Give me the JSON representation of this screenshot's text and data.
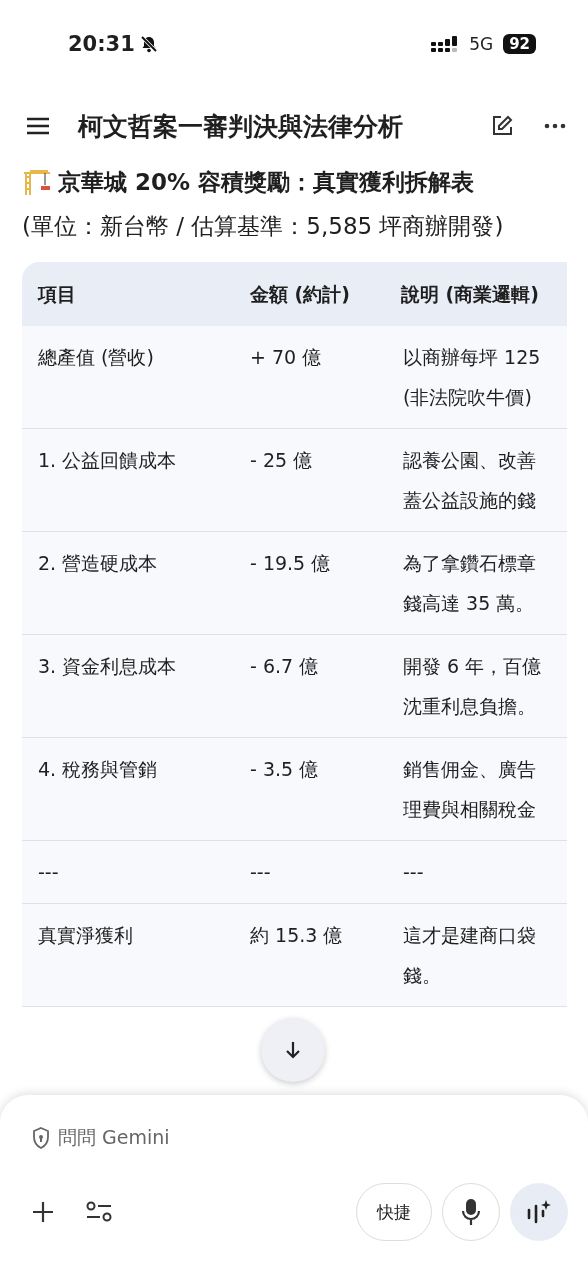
{
  "status_bar": {
    "time": "20:31",
    "network": "5G",
    "battery": "92"
  },
  "header": {
    "title": "柯文哲案一審判決與法律分析"
  },
  "heading": "京華城 20% 容積獎勵：真實獲利拆解表",
  "subtitle": "(單位：新台幣 / 估算基準：5,585 坪商辦開發)",
  "table": {
    "columns": [
      "項目",
      "金額 (約計)",
      "說明 (商業邏輯)"
    ],
    "rows": [
      {
        "item": "總產值 (營收)",
        "amount": "+ 70 億",
        "note": [
          "以商辦每坪 125",
          "(非法院吹牛價)"
        ]
      },
      {
        "item": "1. 公益回饋成本",
        "amount": "- 25 億",
        "note": [
          "認養公園、改善",
          "蓋公益設施的錢"
        ]
      },
      {
        "item": "2. 營造硬成本",
        "amount": "- 19.5 億",
        "note": [
          "為了拿鑽石標章",
          "錢高達 35 萬。"
        ]
      },
      {
        "item": "3. 資金利息成本",
        "amount": "- 6.7 億",
        "note": [
          "開發 6 年，百億",
          "沈重利息負擔。"
        ]
      },
      {
        "item": "4. 稅務與管銷",
        "amount": "- 3.5 億",
        "note": [
          "銷售佣金、廣告",
          "理費與相關稅金"
        ]
      },
      {
        "item": "---",
        "amount": "---",
        "note": [
          "---"
        ]
      },
      {
        "item": "真實淨獲利",
        "amount": "約 15.3 億",
        "note": [
          "這才是建商口袋",
          "錢。"
        ]
      }
    ]
  },
  "composer": {
    "placeholder": "問問 Gemini",
    "shortcut": "快捷"
  }
}
